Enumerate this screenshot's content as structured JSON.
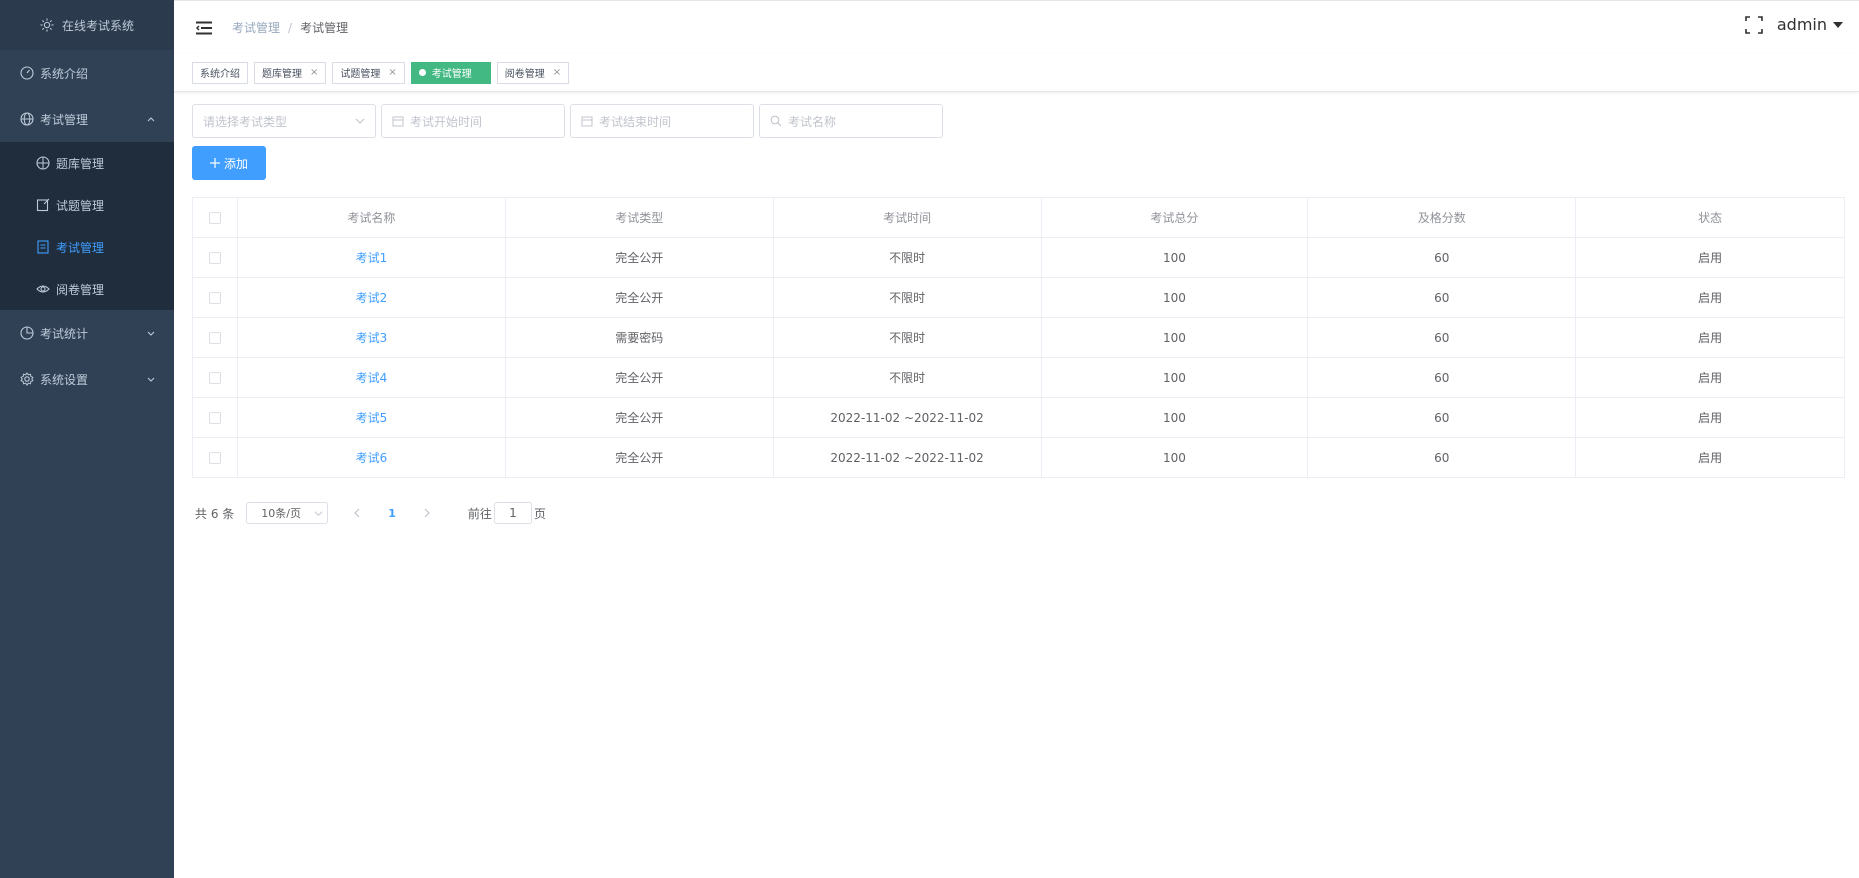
{
  "sidebar": {
    "logo": "在线考试系统",
    "items": [
      {
        "label": "系统介绍",
        "icon": "dashboard-icon"
      },
      {
        "label": "考试管理",
        "icon": "globe-icon",
        "expanded": true,
        "children": [
          {
            "label": "题库管理",
            "icon": "target-icon"
          },
          {
            "label": "试题管理",
            "icon": "edit-icon"
          },
          {
            "label": "考试管理",
            "icon": "document-icon",
            "active": true
          },
          {
            "label": "阅卷管理",
            "icon": "eye-icon"
          }
        ]
      },
      {
        "label": "考试统计",
        "icon": "pie-chart-icon"
      },
      {
        "label": "系统设置",
        "icon": "gear-icon"
      }
    ]
  },
  "header": {
    "breadcrumb": [
      "考试管理",
      "考试管理"
    ],
    "breadcrumb_sep": "/",
    "user": "admin"
  },
  "tags": [
    {
      "label": "系统介绍",
      "closable": false
    },
    {
      "label": "题库管理",
      "closable": true
    },
    {
      "label": "试题管理",
      "closable": true
    },
    {
      "label": "考试管理",
      "active": true
    },
    {
      "label": "阅卷管理",
      "closable": true
    }
  ],
  "tag_close": "×",
  "filters": {
    "type_placeholder": "请选择考试类型",
    "start_placeholder": "考试开始时间",
    "end_placeholder": "考试结束时间",
    "name_placeholder": "考试名称"
  },
  "add_button": "添加",
  "table": {
    "headers": [
      "考试名称",
      "考试类型",
      "考试时间",
      "考试总分",
      "及格分数",
      "状态"
    ],
    "rows": [
      [
        "考试1",
        "完全公开",
        "不限时",
        "100",
        "60",
        "启用"
      ],
      [
        "考试2",
        "完全公开",
        "不限时",
        "100",
        "60",
        "启用"
      ],
      [
        "考试3",
        "需要密码",
        "不限时",
        "100",
        "60",
        "启用"
      ],
      [
        "考试4",
        "完全公开",
        "不限时",
        "100",
        "60",
        "启用"
      ],
      [
        "考试5",
        "完全公开",
        "2022-11-02 ~2022-11-02",
        "100",
        "60",
        "启用"
      ],
      [
        "考试6",
        "完全公开",
        "2022-11-02 ~2022-11-02",
        "100",
        "60",
        "启用"
      ]
    ]
  },
  "pagination": {
    "total": "共 6 条",
    "page_size": "10条/页",
    "current_page": "1",
    "goto_label": "前往",
    "goto_value": "1",
    "goto_suffix": "页"
  },
  "colors": {
    "sidebar_bg": "#304156",
    "primary": "#409eff",
    "active_tag": "#42b983"
  }
}
